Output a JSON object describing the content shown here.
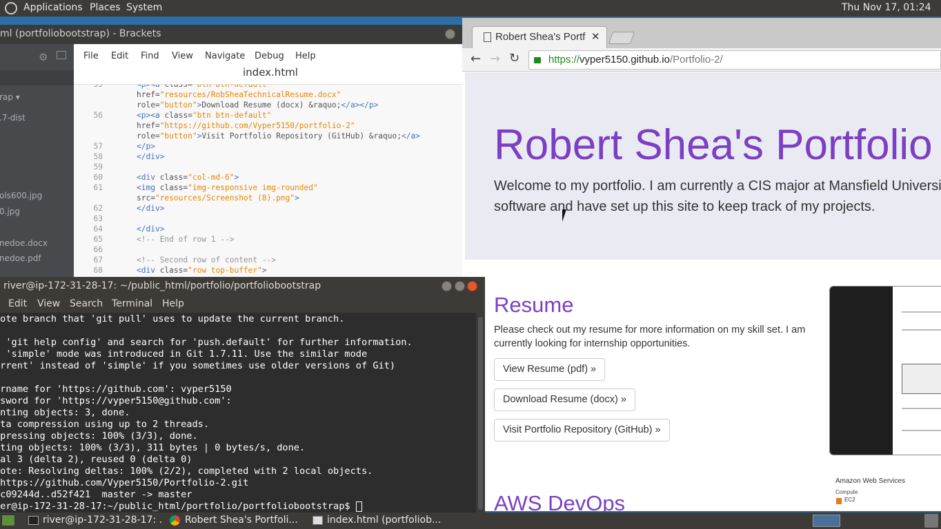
{
  "top_panel": {
    "menus": [
      "Applications",
      "Places",
      "System"
    ],
    "clock": "Thu Nov 17, 01:24"
  },
  "brackets": {
    "title": "ml (portfoliobootstrap) - Brackets",
    "menu": [
      "File",
      "Edit",
      "Find",
      "View",
      "Navigate",
      "Debug",
      "Help"
    ],
    "filename": "index.html",
    "sidebar_files": [
      "rap ▾",
      ".7-dist",
      "ols600.jpg",
      "0.jpg",
      "nedoe.docx",
      "nedoe.pdf"
    ],
    "code_lines": [
      {
        "n": "55",
        "code": "<p><a class=\"btn btn-default\""
      },
      {
        "n": "",
        "code": "href=\"resources/RobSheaTechnicalResume.docx\""
      },
      {
        "n": "",
        "code": "role=\"button\">Download Resume (docx) &raquo;</a></p>"
      },
      {
        "n": "56",
        "code": "<p><a class=\"btn btn-default\""
      },
      {
        "n": "",
        "code": "href=\"https://github.com/Vyper5150/portfolio-2\""
      },
      {
        "n": "",
        "code": "role=\"button\">Visit Portfolio Repository (GitHub) &raquo;</a>"
      },
      {
        "n": "57",
        "code": "</p>"
      },
      {
        "n": "58",
        "code": "</div>"
      },
      {
        "n": "59",
        "code": ""
      },
      {
        "n": "60",
        "code": "<div class=\"col-md-6\">"
      },
      {
        "n": "61",
        "code": "<img class=\"img-responsive img-rounded\""
      },
      {
        "n": "",
        "code": "src=\"resources/Screenshot (8).png\">"
      },
      {
        "n": "62",
        "code": "</div>"
      },
      {
        "n": "63",
        "code": ""
      },
      {
        "n": "64",
        "code": "</div>"
      },
      {
        "n": "65",
        "code": "<!-- End of row 1 -->"
      },
      {
        "n": "66",
        "code": ""
      },
      {
        "n": "67",
        "code": "<!-- Second row of content -->"
      },
      {
        "n": "68",
        "code": "<div class=\"row top-buffer\">"
      }
    ]
  },
  "browser": {
    "tab_title": "Robert Shea's Portf",
    "url_scheme": "https://",
    "url_host": "vyper5150.github.io",
    "url_path": "/Portfolio-2/",
    "page": {
      "heading": "Robert Shea's Portfolio",
      "intro": "Welcome to my portfolio. I am currently a CIS major at Mansfield University. I develop software and have set up this site to keep track of my projects.",
      "resume_heading": "Resume",
      "resume_text": "Please check out my resume for more information on my skill set. I am currently looking for internship opportunities.",
      "btn_view": "View Resume (pdf) »",
      "btn_download": "Download Resume (docx) »",
      "btn_repo": "Visit Portfolio Repository (GitHub) »",
      "aws_heading": "AWS DevOps",
      "aws_shot_title": "Amazon Web Services",
      "aws_shot_compute": "Compute",
      "aws_shot_ec2": "EC2"
    }
  },
  "terminal": {
    "title": "river@ip-172-31-28-17: ~/public_html/portfolio/portfoliobootstrap",
    "menu": [
      "Edit",
      "View",
      "Search",
      "Terminal",
      "Help"
    ],
    "lines": [
      "mote branch that 'git pull' uses to update the current branch.",
      "",
      "e 'git help config' and search for 'push.default' for further information.",
      "e 'simple' mode was introduced in Git 1.7.11. Use the similar mode",
      "urrent' instead of 'simple' if you sometimes use older versions of Git)",
      "",
      "ername for 'https://github.com': vyper5150",
      "ssword for 'https://vyper5150@github.com':",
      "unting objects: 3, done.",
      "lta compression using up to 2 threads.",
      "mpressing objects: 100% (3/3), done.",
      "iting objects: 100% (3/3), 311 bytes | 0 bytes/s, done.",
      "tal 3 (delta 2), reused 0 (delta 0)",
      "mote: Resolving deltas: 100% (2/2), completed with 2 local objects.",
      " https://github.com/Vyper5150/Portfolio-2.git",
      " c09244d..d52f421  master -> master",
      "ver@ip-172-31-28-17:~/public_html/portfolio/portfoliobootstrap$ "
    ]
  },
  "taskbar": {
    "items": [
      "river@ip-172-31-28-17: ...",
      "Robert Shea's Portfoli...",
      "index.html (portfoliob..."
    ]
  }
}
